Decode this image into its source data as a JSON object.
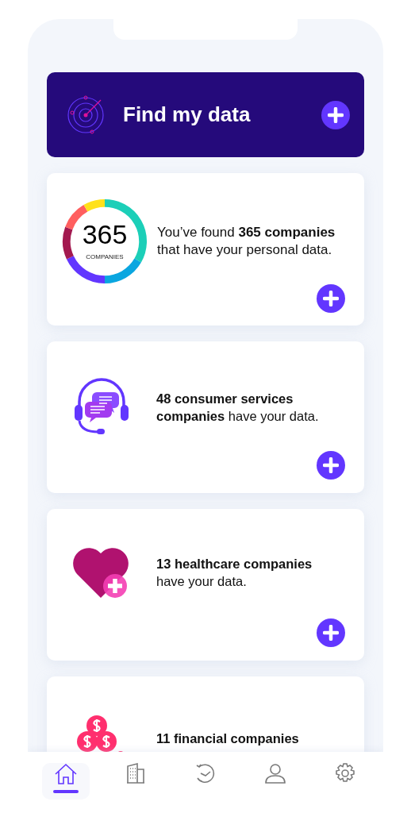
{
  "header": {
    "title": "Find my data"
  },
  "summary": {
    "count": "365",
    "count_caption": "COMPANIES",
    "text": "You’ve found **365 companies** that have your personal data."
  },
  "cards": [
    {
      "kind": "consumer",
      "text": "**48 consumer services companies** have your data."
    },
    {
      "kind": "health",
      "text": "**13 healthcare companies** have your data."
    }
  ],
  "partial_card": {
    "kind": "finance",
    "text": "**11 financial companies**"
  },
  "nav": [
    {
      "kind": "home",
      "selected": true
    },
    {
      "kind": "buildings",
      "selected": false
    },
    {
      "kind": "history",
      "selected": false
    },
    {
      "kind": "profile",
      "selected": false
    },
    {
      "kind": "settings",
      "selected": false
    }
  ]
}
